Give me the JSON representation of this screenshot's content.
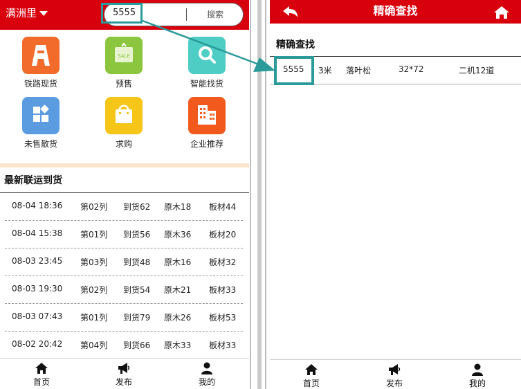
{
  "left": {
    "city": "满洲里",
    "search": {
      "value": "5555",
      "button": "搜索"
    },
    "grid": [
      {
        "label": "铁路现货",
        "icon": "rail-icon",
        "color": "#f26b2a"
      },
      {
        "label": "预售",
        "icon": "sale-tag-icon",
        "color": "#8cc63f",
        "tag": "SALE"
      },
      {
        "label": "智能找货",
        "icon": "search-icon",
        "color": "#4ecdc4"
      },
      {
        "label": "未售散货",
        "icon": "blocks-icon",
        "color": "#5b9be0"
      },
      {
        "label": "求购",
        "icon": "shopping-bag-icon",
        "color": "#f5c518"
      },
      {
        "label": "企业推荐",
        "icon": "building-icon",
        "color": "#f25a1d"
      }
    ],
    "section_title": "最新联运到货",
    "rows": [
      {
        "time": "08-04 18:36",
        "train": "第02列",
        "arrived": "到货62",
        "log": "原木18",
        "board": "板材44"
      },
      {
        "time": "08-04 15:38",
        "train": "第01列",
        "arrived": "到货56",
        "log": "原木36",
        "board": "板材20"
      },
      {
        "time": "08-03 23:45",
        "train": "第03列",
        "arrived": "到货48",
        "log": "原木16",
        "board": "板材32"
      },
      {
        "time": "08-03 19:30",
        "train": "第02列",
        "arrived": "到货54",
        "log": "原木21",
        "board": "板材33"
      },
      {
        "time": "08-03 07:43",
        "train": "第01列",
        "arrived": "到货79",
        "log": "原木26",
        "board": "板材53"
      },
      {
        "time": "08-02 20:42",
        "train": "第04列",
        "arrived": "到货66",
        "log": "原木33",
        "board": "板材33"
      }
    ],
    "nav": [
      {
        "label": "首页",
        "icon": "home-icon"
      },
      {
        "label": "发布",
        "icon": "megaphone-icon"
      },
      {
        "label": "我的",
        "icon": "user-icon"
      }
    ]
  },
  "right": {
    "title": "精确查找",
    "section_title": "精确查找",
    "result": {
      "code": "5555",
      "length": "3米",
      "species": "落叶松",
      "size": "32*72",
      "location": "二机12道"
    },
    "nav": [
      {
        "label": "首页",
        "icon": "home-icon"
      },
      {
        "label": "发布",
        "icon": "megaphone-icon"
      },
      {
        "label": "我的",
        "icon": "user-icon"
      }
    ]
  },
  "colors": {
    "brand_red": "#d9000d",
    "highlight": "#2a9a9a",
    "section_band": "#fbe5cc"
  }
}
